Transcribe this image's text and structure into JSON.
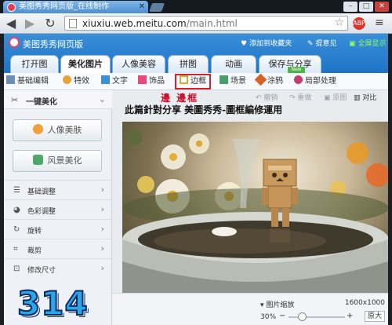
{
  "browser": {
    "tab_title": "美图秀秀网页版_在线制作",
    "tab_close": "✕",
    "url_domain": "xiuxiu.web.meitu.com",
    "url_path": "/main.html",
    "ext_badge": "ABP"
  },
  "app": {
    "title": "美图秀秀网页版",
    "header_links": {
      "favorite": "添加到收藏夹",
      "feedback": "提意见",
      "fullscreen": "全屏显示"
    },
    "main_tabs": [
      "打开图片",
      "美化图片",
      "人像美容",
      "拼图",
      "动画",
      "保存与分享"
    ],
    "sub_tools": [
      "基础编辑",
      "特效",
      "文字",
      "饰品",
      "边框",
      "场景",
      "涂鸦",
      "局部处理"
    ],
    "new_badge": "New",
    "left_panel": {
      "one_click": "一键美化",
      "buttons": [
        "人像美肤",
        "风景美化"
      ],
      "rows": [
        "基础调整",
        "色彩调整",
        "旋转",
        "裁剪",
        "修改尺寸"
      ]
    },
    "canvas_toolbar": {
      "undo": "撤销",
      "redo": "重做",
      "original": "原图",
      "compare": "对比"
    },
    "zoom": {
      "label": "图片缩放",
      "image_size": "1600x1000",
      "percent": "30%",
      "minus": "−",
      "plus": "+",
      "original_size": "原大",
      "level": 0.3
    }
  },
  "overlay": {
    "title": "邊 邊框",
    "subtitle": "此篇針對分享 美圖秀秀-圖框編修運用",
    "stamp": "314"
  },
  "colors": {
    "accent": "#1e73c6",
    "highlight": "#d2232a",
    "overlay_title": "#c8102e",
    "stamp": "#2aa7e7"
  }
}
